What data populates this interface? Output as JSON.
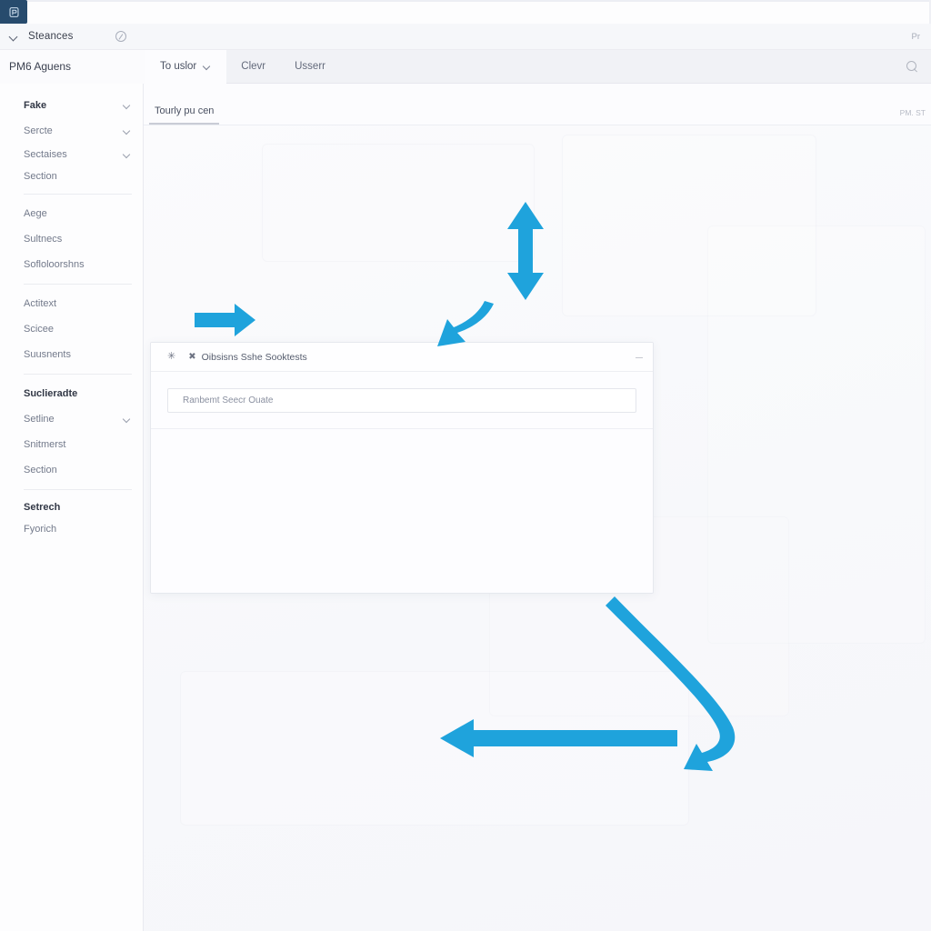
{
  "app": {
    "logo_icon": "app-logo-icon",
    "accent_blue": "#1FA3DC",
    "logo_bg": "#274B6D"
  },
  "topbar_primary": {
    "chevron_icon": "chevron-down-icon",
    "title": "Steances",
    "status_icon": "help-circle-icon",
    "right_text": "Pr"
  },
  "topbar_secondary": {
    "brand": "PM6 Aguens",
    "items": [
      {
        "label": "To uslor",
        "has_caret": true,
        "active": true
      },
      {
        "label": "Clevr",
        "has_caret": false,
        "active": false
      },
      {
        "label": "Usserr",
        "has_caret": false,
        "active": false
      }
    ],
    "search_icon": "search-icon"
  },
  "sidebar": {
    "groups": [
      {
        "items": [
          {
            "label": "Fake",
            "bold": true,
            "caret": true
          },
          {
            "label": "Sercte",
            "bold": false,
            "caret": true
          },
          {
            "label": "Sectaises",
            "bold": false,
            "caret": true
          },
          {
            "label": "Section",
            "bold": false,
            "caret": false
          }
        ]
      },
      {
        "items": [
          {
            "label": "Aege",
            "bold": false,
            "caret": false
          },
          {
            "label": "Sultnecs",
            "bold": false,
            "caret": false
          },
          {
            "label": "Sofloloorshns",
            "bold": false,
            "caret": false
          }
        ]
      },
      {
        "items": [
          {
            "label": "Actitext",
            "bold": false,
            "caret": false
          },
          {
            "label": "Scicee",
            "bold": false,
            "caret": false
          },
          {
            "label": "Suusnents",
            "bold": false,
            "caret": false
          }
        ]
      },
      {
        "items": [
          {
            "label": "Suclieradte",
            "bold": true,
            "caret": false
          },
          {
            "label": "Setline",
            "bold": false,
            "caret": true
          },
          {
            "label": "Snitmerst",
            "bold": false,
            "caret": false
          },
          {
            "label": "Section",
            "bold": false,
            "caret": false
          }
        ]
      },
      {
        "items": [
          {
            "label": "Setrech",
            "bold": true,
            "caret": false
          },
          {
            "label": "Fyorich",
            "bold": false,
            "caret": false
          }
        ]
      }
    ]
  },
  "content_header": {
    "tab_label": "Tourly pu cen",
    "right_text": "PM. ST"
  },
  "dialog": {
    "star_icon": "star-icon",
    "pin_icon": "pin-icon",
    "title": "Oibsisns Sshe Sooktests",
    "collapse_icon": "collapse-icon",
    "input_value": "Ranbemt Seecr Ouate",
    "input_placeholder": "Ranbemt Seecr Ouate"
  },
  "annotations": {
    "arrows": [
      {
        "name": "arrow-right-to-dialog",
        "kind": "straight-right"
      },
      {
        "name": "arrow-vertical-double",
        "kind": "double-vertical"
      },
      {
        "name": "arrow-curved-down-left",
        "kind": "curve-down-left"
      },
      {
        "name": "arrow-curved-loop-left",
        "kind": "curve-loop-left"
      },
      {
        "name": "arrow-left-long",
        "kind": "straight-left"
      }
    ]
  }
}
